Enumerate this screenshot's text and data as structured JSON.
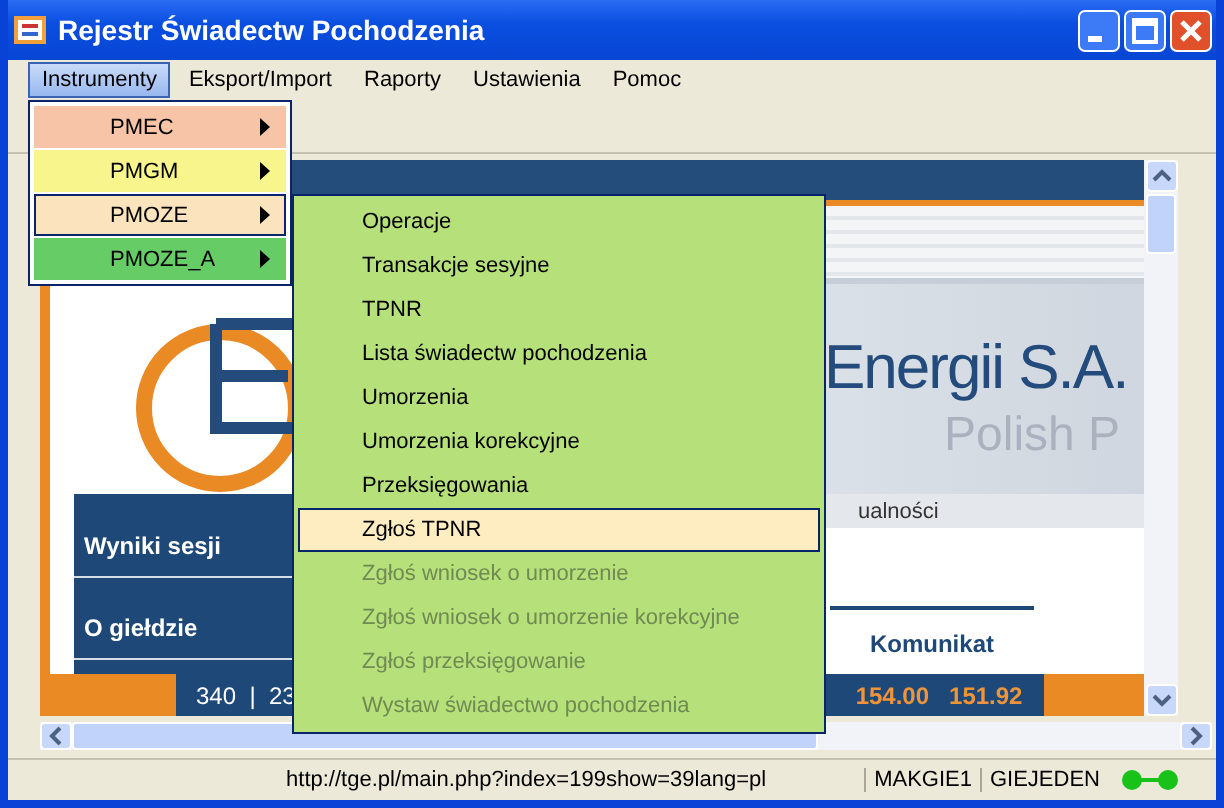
{
  "window": {
    "title": "Rejestr Świadectw Pochodzenia"
  },
  "menu_bar": [
    {
      "label": "Instrumenty",
      "selected": true
    },
    {
      "label": "Eksport/Import",
      "selected": false
    },
    {
      "label": "Raporty",
      "selected": false
    },
    {
      "label": "Ustawienia",
      "selected": false
    },
    {
      "label": "Pomoc",
      "selected": false
    }
  ],
  "dropdown": [
    {
      "label": "PMEC",
      "color": "#f7c4a8",
      "selected": false
    },
    {
      "label": "PMGM",
      "color": "#f7f58b",
      "selected": false
    },
    {
      "label": "PMOZE",
      "color": "#fbe4bd",
      "selected": true
    },
    {
      "label": "PMOZE_A",
      "color": "#66cc66",
      "selected": false
    }
  ],
  "submenu": [
    {
      "label": "Operacje",
      "selected": false,
      "disabled": false
    },
    {
      "label": "Transakcje sesyjne",
      "selected": false,
      "disabled": false
    },
    {
      "label": "TPNR",
      "selected": false,
      "disabled": false
    },
    {
      "label": "Lista świadectw pochodzenia",
      "selected": false,
      "disabled": false
    },
    {
      "label": "Umorzenia",
      "selected": false,
      "disabled": false
    },
    {
      "label": "Umorzenia korekcyjne",
      "selected": false,
      "disabled": false
    },
    {
      "label": "Przeksięgowania",
      "selected": false,
      "disabled": false
    },
    {
      "label": "Zgłoś TPNR",
      "selected": true,
      "disabled": false
    },
    {
      "label": "Zgłoś wniosek o umorzenie",
      "selected": false,
      "disabled": true
    },
    {
      "label": "Zgłoś wniosek o umorzenie korekcyjne",
      "selected": false,
      "disabled": true
    },
    {
      "label": "Zgłoś przeksięgowanie",
      "selected": false,
      "disabled": true
    },
    {
      "label": "Wystaw świadectwo pochodzenia",
      "selected": false,
      "disabled": true
    }
  ],
  "web_page": {
    "banner_title": "Energii S.A.",
    "banner_subtitle": "Polish P",
    "news_tab": "ualności",
    "nav": [
      "Wyniki sesji",
      "O giełdzie"
    ],
    "notice_heading": "Komunikat",
    "ticker_left": "340  |  23",
    "ticker_values": [
      "154.00",
      "151.92"
    ]
  },
  "status_bar": {
    "url": "http://tge.pl/main.php?index=199show=39lang=pl",
    "user": "MAKGIE1",
    "group": "GIEJEDEN"
  }
}
